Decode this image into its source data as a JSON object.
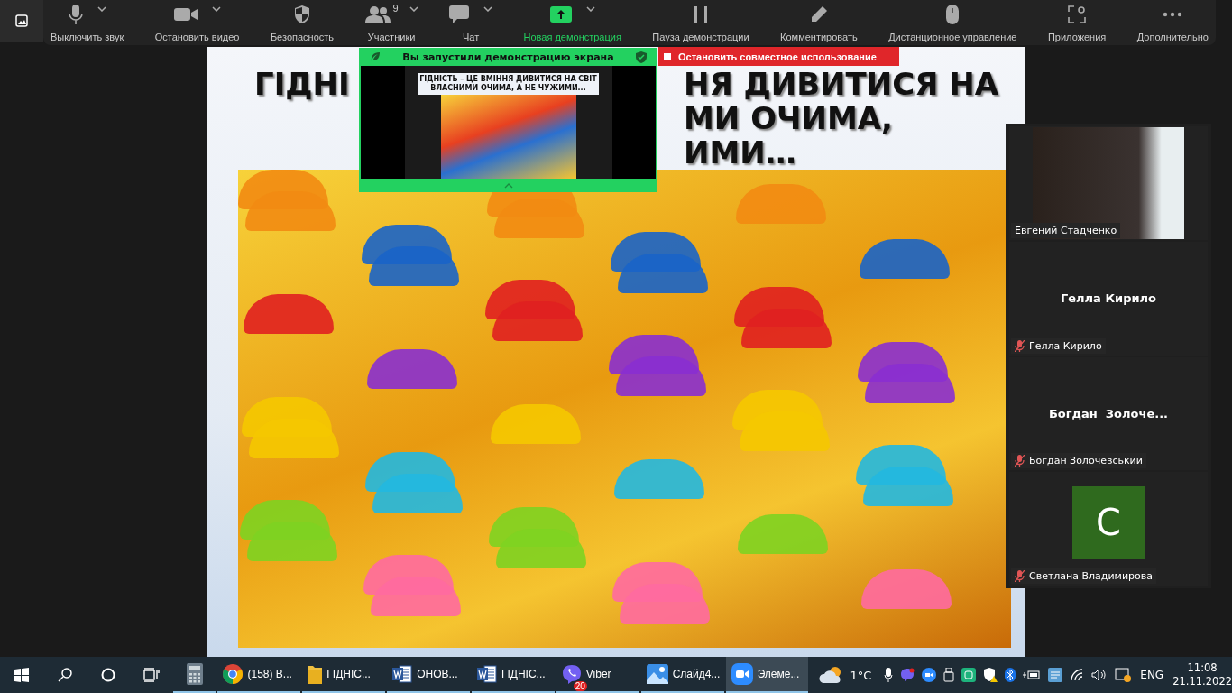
{
  "toolbar": {
    "items": [
      {
        "kind": "mic",
        "label": "Выключить звук",
        "menu": true,
        "highlighted": false
      },
      {
        "kind": "video",
        "label": "Остановить видео",
        "menu": true,
        "highlighted": false
      },
      {
        "kind": "shield",
        "label": "Безопасность",
        "menu": false,
        "highlighted": false
      },
      {
        "kind": "people",
        "label": "Участники",
        "count": "9",
        "menu": true,
        "highlighted": false
      },
      {
        "kind": "chat",
        "label": "Чат",
        "menu": true,
        "highlighted": false
      },
      {
        "kind": "share",
        "label": "Новая демонстрация",
        "menu": true,
        "highlighted": true
      },
      {
        "kind": "pause",
        "label": "Пауза демонстрации",
        "menu": false,
        "highlighted": false
      },
      {
        "kind": "pencil",
        "label": "Комментировать",
        "menu": false,
        "highlighted": false
      },
      {
        "kind": "mouse",
        "label": "Дистанционное управление",
        "menu": false,
        "highlighted": false
      },
      {
        "kind": "apps",
        "label": "Приложения",
        "menu": false,
        "highlighted": false
      },
      {
        "kind": "more",
        "label": "Дополнительно",
        "menu": false,
        "highlighted": false
      }
    ]
  },
  "slide": {
    "title_lines": [
      {
        "left": "ГІДНІ",
        "right": "НЯ ДИВИТИСЯ НА"
      },
      {
        "right": "МИ ОЧИМА,"
      },
      {
        "right": "ИМИ…"
      }
    ]
  },
  "share_banner": {
    "title": "Вы запустили демонстрацию экрана",
    "preview_caption": "ГІДНІСТЬ – ЦЕ ВМІННЯ ДИВИТИСЯ НА СВІТ ВЛАСНИМИ ОЧИМА, А НЕ ЧУЖИМИ..."
  },
  "stop_share": {
    "label": "Остановить совместное использование"
  },
  "participants": [
    {
      "kind": "video",
      "name": "Евгений Стадченко",
      "muted": false
    },
    {
      "kind": "name",
      "display": "Гелла Кирило",
      "name": "Гелла Кирило",
      "muted": true
    },
    {
      "kind": "name",
      "display": "Богдан  Золоче...",
      "name": "Богдан Золочевський",
      "muted": true
    },
    {
      "kind": "avatar",
      "initial": "С",
      "color": "#2f6a1e",
      "name": "Светлана Владимирова",
      "muted": true
    }
  ],
  "taskbar": {
    "apps": [
      {
        "kind": "calculator",
        "selected": false
      },
      {
        "kind": "chrome",
        "label": "(158) В...",
        "selected": false
      },
      {
        "kind": "folder",
        "label": "ГІДНІС...",
        "selected": false
      },
      {
        "kind": "word",
        "label": "ОНОВ...",
        "selected": false
      },
      {
        "kind": "word",
        "label": "ГІДНІС...",
        "selected": false
      },
      {
        "kind": "viber",
        "label": "Viber",
        "badge": "20",
        "selected": false
      },
      {
        "kind": "photos",
        "label": "Слайд4...",
        "selected": false
      },
      {
        "kind": "zoom",
        "label": "Элеме...",
        "selected": true
      }
    ],
    "weather": "1°C",
    "language": "ENG",
    "time": "11:08",
    "date": "21.11.2022"
  }
}
